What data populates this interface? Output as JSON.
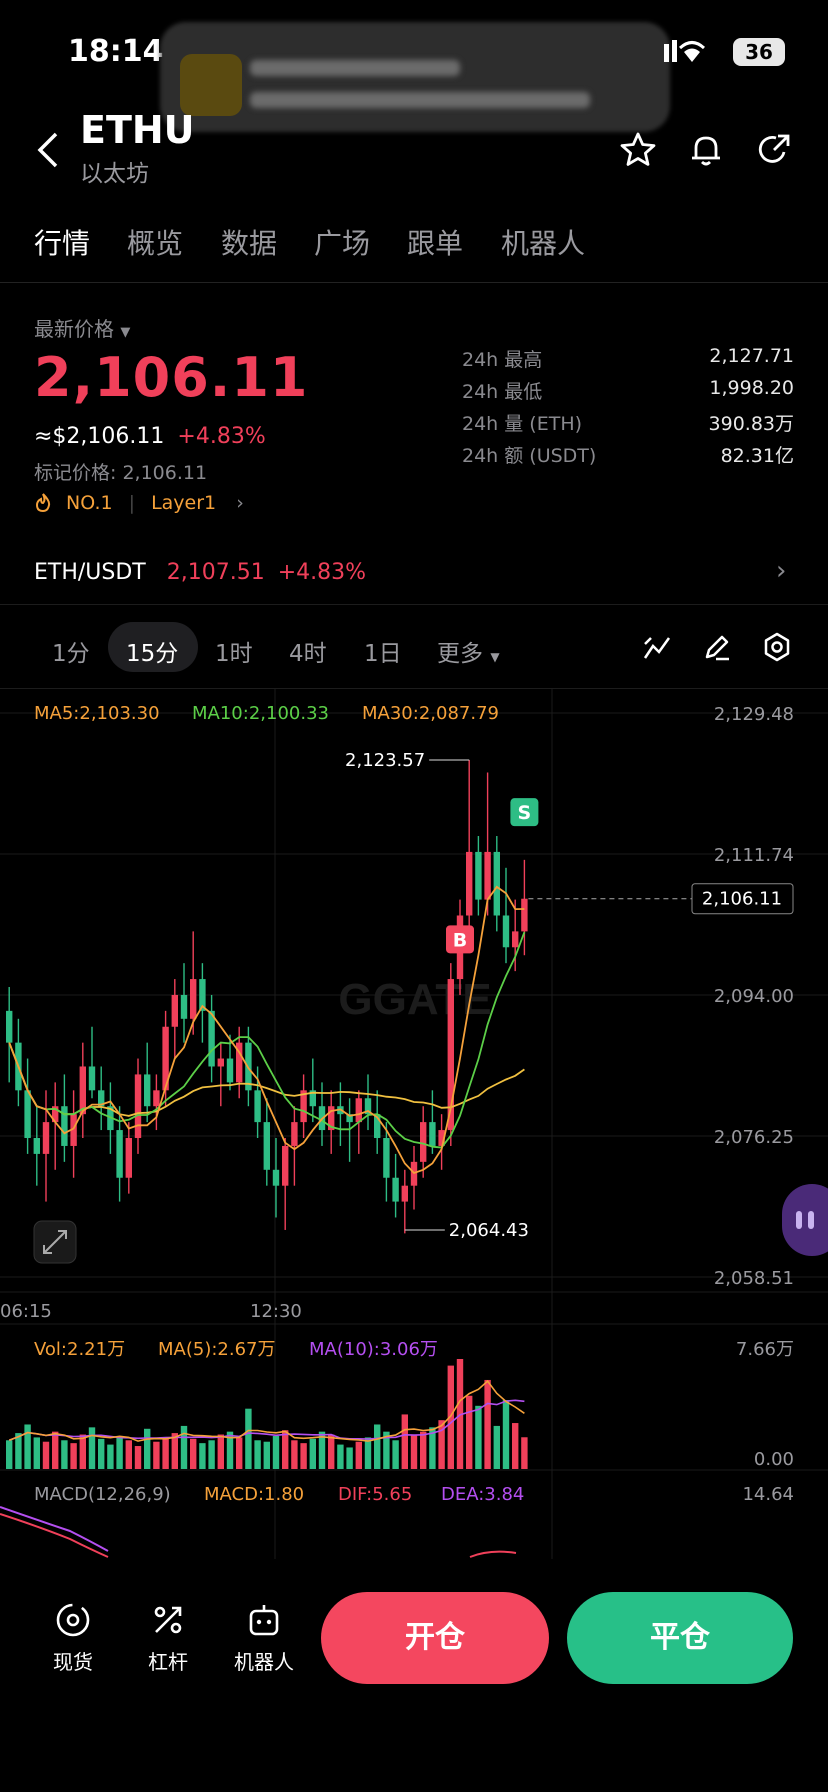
{
  "status_bar": {
    "time": "18:14",
    "battery": "36"
  },
  "header": {
    "title": "ETHU",
    "subtitle": "以太坊"
  },
  "tabs": [
    {
      "label": "行情",
      "active": true
    },
    {
      "label": "概览"
    },
    {
      "label": "数据"
    },
    {
      "label": "广场"
    },
    {
      "label": "跟单"
    },
    {
      "label": "机器人"
    }
  ],
  "price": {
    "label": "最新价格",
    "last": "2,106.11",
    "usd": "≈$2,106.11",
    "change": "+4.83%",
    "mark": "标记价格: 2,106.11",
    "rank": "NO.1",
    "tag": "Layer1"
  },
  "stats": [
    {
      "label": "24h  最高",
      "value": "2,127.71"
    },
    {
      "label": "24h  最低",
      "value": "1,998.20"
    },
    {
      "label": "24h  量 (ETH)",
      "value": "390.83万"
    },
    {
      "label": "24h  额 (USDT)",
      "value": "82.31亿"
    }
  ],
  "pair": {
    "symbol": "ETH/USDT",
    "price": "2,107.51",
    "change": "+4.83%"
  },
  "timeframes": [
    "1分",
    "15分",
    "1时",
    "4时",
    "1日",
    "更多"
  ],
  "indicators": {
    "ma5": "MA5:2,103.30",
    "ma10": "MA10:2,100.33",
    "ma30": "MA30:2,087.79",
    "vol": "Vol:2.21万",
    "vol_ma5": "MA(5):2.67万",
    "vol_ma10": "MA(10):3.06万",
    "macd_label": "MACD(12,26,9)",
    "macd": "MACD:1.80",
    "dif": "DIF:5.65",
    "dea": "DEA:3.84"
  },
  "colors": {
    "up": "#f0405a",
    "down": "#2ebd85",
    "ma5": "#f5a13a",
    "ma10": "#5ccf48",
    "ma30": "#f0c040",
    "buy_button": "#f4475f",
    "sell_button": "#27c088"
  },
  "chart_data": {
    "type": "candlestick",
    "y_ticks": [
      "2,129.48",
      "2,111.74",
      "2,094.00",
      "2,076.25",
      "2,058.51"
    ],
    "ylim": [
      2058.51,
      2129.48
    ],
    "x_ticks": [
      "06:15",
      "12:30"
    ],
    "last_price": "2,106.11",
    "high_label": "2,123.57",
    "low_label": "2,064.43",
    "high_value": 2123.57,
    "low_value": 2064.43,
    "markers": [
      {
        "type": "B"
      },
      {
        "type": "S"
      }
    ],
    "vol_ticks": [
      "7.66万",
      "0.00"
    ],
    "macd_tick": "14.64",
    "candles": [
      [
        2092,
        2095,
        2083,
        2088
      ],
      [
        2088,
        2091,
        2080,
        2082
      ],
      [
        2082,
        2086,
        2074,
        2076
      ],
      [
        2076,
        2080,
        2070,
        2074
      ],
      [
        2074,
        2082,
        2068,
        2078
      ],
      [
        2078,
        2083,
        2072,
        2080
      ],
      [
        2080,
        2084,
        2073,
        2075
      ],
      [
        2075,
        2082,
        2071,
        2079
      ],
      [
        2079,
        2088,
        2076,
        2085
      ],
      [
        2085,
        2090,
        2081,
        2082
      ],
      [
        2082,
        2085,
        2077,
        2080
      ],
      [
        2080,
        2083,
        2074,
        2077
      ],
      [
        2077,
        2080,
        2068,
        2071
      ],
      [
        2071,
        2078,
        2069,
        2076
      ],
      [
        2076,
        2086,
        2074,
        2084
      ],
      [
        2084,
        2088,
        2078,
        2080
      ],
      [
        2080,
        2084,
        2077,
        2082
      ],
      [
        2082,
        2092,
        2080,
        2090
      ],
      [
        2090,
        2096,
        2086,
        2094
      ],
      [
        2094,
        2098,
        2088,
        2091
      ],
      [
        2091,
        2102,
        2089,
        2096
      ],
      [
        2096,
        2098,
        2088,
        2092
      ],
      [
        2092,
        2094,
        2083,
        2085
      ],
      [
        2085,
        2088,
        2080,
        2086
      ],
      [
        2086,
        2089,
        2082,
        2083
      ],
      [
        2083,
        2090,
        2081,
        2088
      ],
      [
        2088,
        2090,
        2080,
        2082
      ],
      [
        2082,
        2085,
        2076,
        2078
      ],
      [
        2078,
        2081,
        2070,
        2072
      ],
      [
        2072,
        2076,
        2066,
        2070
      ],
      [
        2070,
        2076,
        2064.43,
        2075
      ],
      [
        2075,
        2080,
        2070,
        2078
      ],
      [
        2078,
        2084,
        2076,
        2082
      ],
      [
        2082,
        2086,
        2078,
        2080
      ],
      [
        2080,
        2083,
        2075,
        2077
      ],
      [
        2077,
        2082,
        2074,
        2080
      ],
      [
        2080,
        2083,
        2075,
        2079
      ],
      [
        2079,
        2081,
        2073,
        2078
      ],
      [
        2078,
        2082,
        2074,
        2081
      ],
      [
        2081,
        2084,
        2077,
        2079
      ],
      [
        2079,
        2082,
        2074,
        2076
      ],
      [
        2076,
        2078,
        2068,
        2071
      ],
      [
        2071,
        2074,
        2066,
        2068
      ],
      [
        2068,
        2072,
        2064,
        2070
      ],
      [
        2070,
        2075,
        2067,
        2073
      ],
      [
        2073,
        2080,
        2071,
        2078
      ],
      [
        2078,
        2082,
        2074,
        2075
      ],
      [
        2075,
        2079,
        2072,
        2077
      ],
      [
        2077,
        2098,
        2075,
        2096
      ],
      [
        2096,
        2106,
        2094,
        2104
      ],
      [
        2104,
        2123.57,
        2100,
        2112
      ],
      [
        2112,
        2114,
        2104,
        2106
      ],
      [
        2106,
        2122,
        2104,
        2112
      ],
      [
        2112,
        2114,
        2102,
        2104
      ],
      [
        2104,
        2110,
        2098,
        2100
      ],
      [
        2100,
        2106,
        2097,
        2102
      ],
      [
        2102,
        2111,
        2099,
        2106.11
      ]
    ],
    "volumes": [
      2.0,
      2.5,
      3.1,
      2.2,
      1.9,
      2.6,
      2.0,
      1.8,
      2.4,
      2.9,
      2.1,
      1.7,
      2.3,
      2.0,
      1.6,
      2.8,
      1.9,
      2.2,
      2.5,
      3.0,
      2.1,
      1.8,
      2.0,
      2.4,
      2.6,
      2.2,
      4.2,
      2.0,
      1.9,
      2.3,
      2.7,
      2.0,
      1.8,
      2.1,
      2.6,
      2.4,
      1.7,
      1.5,
      1.9,
      2.2,
      3.1,
      2.6,
      2.0,
      3.8,
      2.4,
      2.6,
      2.9,
      3.4,
      7.2,
      7.66,
      5.1,
      4.4,
      6.2,
      3.0,
      4.8,
      3.2,
      2.21
    ]
  },
  "bottom_nav": [
    {
      "label": "现货",
      "icon": "spot-icon"
    },
    {
      "label": "杠杆",
      "icon": "leverage-icon"
    },
    {
      "label": "机器人",
      "icon": "robot-icon"
    }
  ],
  "actions": {
    "open": "开仓",
    "close": "平仓"
  }
}
